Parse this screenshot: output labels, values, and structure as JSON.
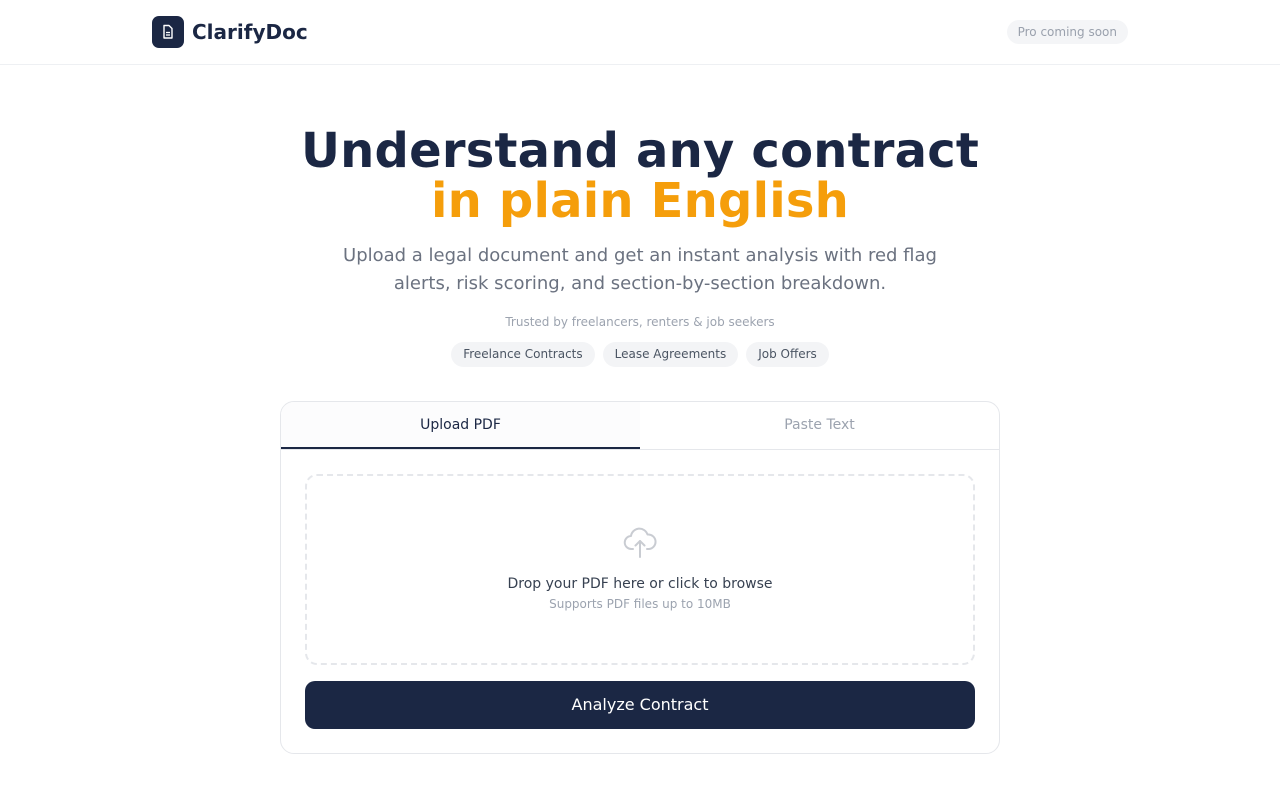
{
  "header": {
    "brand_name": "ClarifyDoc",
    "brand_icon": "document-icon",
    "badge": "Pro coming soon"
  },
  "hero": {
    "title_line1": "Understand any contract",
    "title_line2": "in plain English",
    "subtitle": "Upload a legal document and get an instant analysis with red flag alerts, risk scoring, and section-by-section breakdown.",
    "trusted": "Trusted by freelancers, renters & job seekers",
    "tags": [
      "Freelance Contracts",
      "Lease Agreements",
      "Job Offers"
    ]
  },
  "upload": {
    "tabs": [
      {
        "label": "Upload PDF",
        "active": true
      },
      {
        "label": "Paste Text",
        "active": false
      }
    ],
    "drop_icon": "cloud-upload-icon",
    "drop_title": "Drop your PDF here or click to browse",
    "drop_subtitle": "Supports PDF files up to 10MB",
    "button": "Analyze Contract"
  },
  "colors": {
    "primary": "#1b2744",
    "accent": "#f59e0b"
  }
}
